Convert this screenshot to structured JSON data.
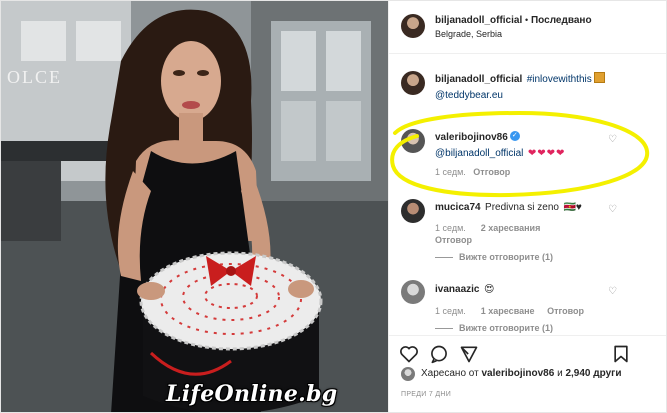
{
  "post": {
    "author": "biljanadoll_official",
    "separator": "•",
    "follow_label": "Последвано",
    "location": "Belgrade, Serbia"
  },
  "photo": {
    "storefront_text": "OLCE",
    "watermark": "LifeOnline.bg"
  },
  "caption": {
    "user": "biljanadoll_official",
    "hashtag": "#inlovewiththis",
    "mention": "@teddybear.eu"
  },
  "comments": [
    {
      "user": "valeribojinov86",
      "verified": true,
      "mention": "@biljanadoll_official",
      "hearts": "❤❤❤❤",
      "time": "1 седм.",
      "reply_label": "Отговор"
    },
    {
      "user": "mucica74",
      "text": "Predivna si zeno",
      "emoji": "🇸🇷♥",
      "time": "1 седм.",
      "likes": "2 харесвания",
      "reply_label": "Отговор",
      "view_replies": "Вижте отговорите (1)"
    },
    {
      "user": "ivanaazic",
      "emoji": "😍",
      "time": "1 седм.",
      "likes": "1 харесване",
      "reply_label": "Отговор",
      "view_replies": "Вижте отговорите (1)"
    }
  ],
  "likes_line": {
    "prefix": "Харесано от",
    "user": "valeribojinov86",
    "middle": "и",
    "count": "2,940",
    "suffix": "други"
  },
  "timestamp": "ПРЕДИ 7 ДНИ",
  "colors": {
    "highlight_ring": "#f4f000",
    "heart_red": "#e0245e",
    "verified_blue": "#3897f0",
    "link_blue": "#003569"
  },
  "icons": [
    "heart-icon",
    "comment-icon",
    "share-icon",
    "bookmark-icon",
    "verified-badge-icon",
    "gift-icon"
  ]
}
